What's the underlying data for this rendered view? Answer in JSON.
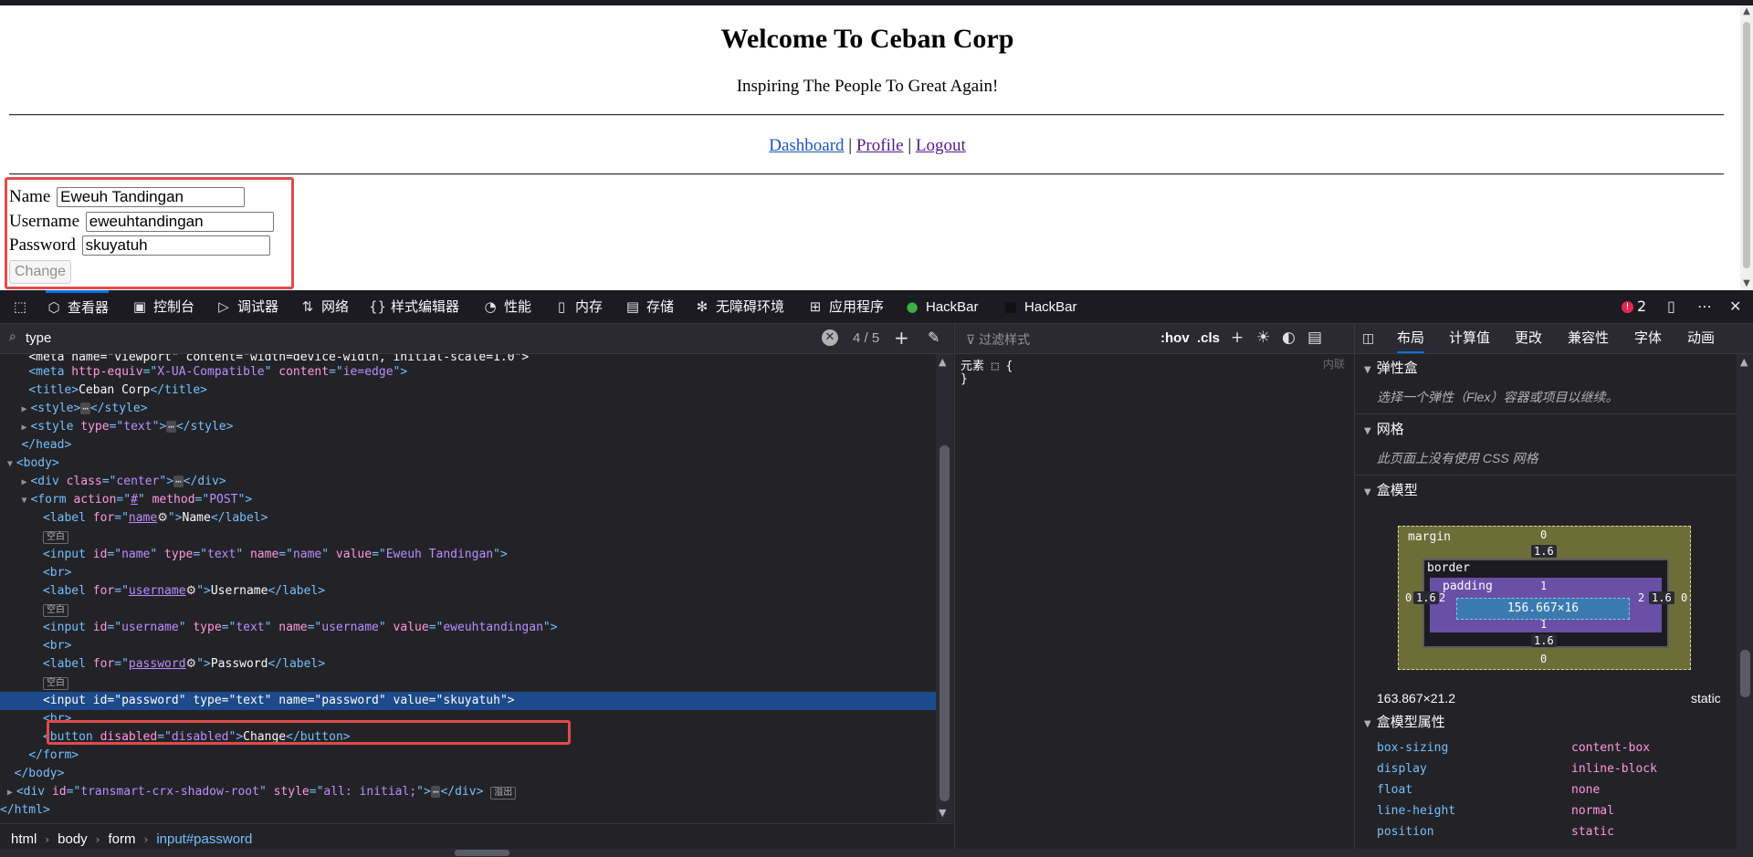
{
  "page": {
    "title": "Welcome To Ceban Corp",
    "subtitle": "Inspiring The People To Great Again!",
    "nav": {
      "dashboard": "Dashboard",
      "profile": "Profile",
      "logout": "Logout",
      "sep": "|"
    },
    "form": {
      "name_label": "Name",
      "name_value": "Eweuh Tandingan",
      "username_label": "Username",
      "username_value": "eweuhtandingan",
      "password_label": "Password",
      "password_value": "skuyatuh",
      "change_label": "Change"
    }
  },
  "devtools": {
    "tabs": [
      {
        "label": "查看器",
        "icon": "inspector-icon"
      },
      {
        "label": "控制台",
        "icon": "console-icon"
      },
      {
        "label": "调试器",
        "icon": "debugger-icon"
      },
      {
        "label": "网络",
        "icon": "network-icon"
      },
      {
        "label": "样式编辑器",
        "icon": "style-editor-icon"
      },
      {
        "label": "性能",
        "icon": "performance-icon"
      },
      {
        "label": "内存",
        "icon": "memory-icon"
      },
      {
        "label": "存储",
        "icon": "storage-icon"
      },
      {
        "label": "无障碍环境",
        "icon": "accessibility-icon"
      },
      {
        "label": "应用程序",
        "icon": "application-icon"
      },
      {
        "label": "HackBar",
        "icon": "hackbar-green-icon"
      },
      {
        "label": "HackBar",
        "icon": "hackbar-dark-icon"
      }
    ],
    "error_count": "2",
    "search": {
      "value": "type",
      "count": "4 / 5"
    },
    "markup": {
      "l0": "<meta name=\"viewport\" content=\"width=device-width, initial-scale=1.0\">",
      "title_text": "Ceban Corp",
      "name_attr": "Eweuh Tandingan",
      "username_attr": "eweuhtandingan",
      "password_attr": "skuyatuh",
      "label_name": "Name",
      "label_username": "Username",
      "label_password": "Password",
      "button_text": "Change",
      "whitespace_badge": "空白",
      "overflow_badge": "溢出"
    },
    "breadcrumbs": [
      "html",
      "body",
      "form",
      "input#password"
    ],
    "rules": {
      "filter_placeholder": "过滤样式",
      "hov": ":hov",
      "cls": ".cls",
      "element_rule": "元素 ⬚ {",
      "close": "}",
      "inline": "内联"
    },
    "layout": {
      "tabs": [
        "布局",
        "计算值",
        "更改",
        "兼容性",
        "字体",
        "动画"
      ],
      "flexbox": "弹性盒",
      "flexbox_note": "选择一个弹性（Flex）容器或项目以继续。",
      "grid": "网格",
      "grid_note": "此页面上没有使用 CSS 网格",
      "boxmodel": "盒模型",
      "box": {
        "margin_label": "margin",
        "border_label": "border",
        "padding_label": "padding",
        "margin_top": "0",
        "margin_bottom": "0",
        "margin_left": "0",
        "margin_right": "0",
        "border_top": "1.6",
        "border_bottom": "1.6",
        "border_left": "1.6",
        "border_right": "1.6",
        "padding_top": "1",
        "padding_bottom": "1",
        "padding_left": "2",
        "padding_right": "2",
        "content": "156.667×16"
      },
      "dims": "163.867×21.2",
      "position": "static",
      "props_title": "盒模型属性",
      "props": [
        {
          "name": "box-sizing",
          "value": "content-box"
        },
        {
          "name": "display",
          "value": "inline-block"
        },
        {
          "name": "float",
          "value": "none"
        },
        {
          "name": "line-height",
          "value": "normal"
        },
        {
          "name": "position",
          "value": "static"
        }
      ]
    }
  }
}
